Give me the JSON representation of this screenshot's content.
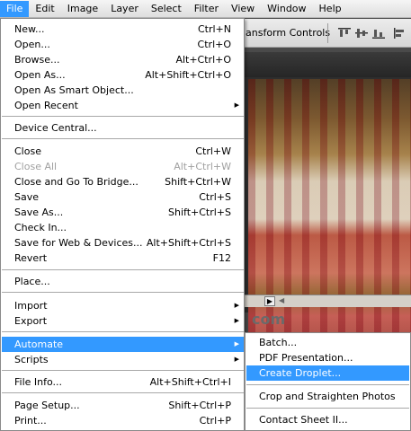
{
  "menubar": {
    "file": "File",
    "edit": "Edit",
    "image": "Image",
    "layer": "Layer",
    "select": "Select",
    "filter": "Filter",
    "view": "View",
    "window": "Window",
    "help": "Help"
  },
  "options": {
    "transform_controls": "ansform Controls"
  },
  "document": {
    "watermark": "com"
  },
  "file_menu": {
    "new": {
      "label": "New...",
      "shortcut": "Ctrl+N"
    },
    "open": {
      "label": "Open...",
      "shortcut": "Ctrl+O"
    },
    "browse": {
      "label": "Browse...",
      "shortcut": "Alt+Ctrl+O"
    },
    "open_as": {
      "label": "Open As...",
      "shortcut": "Alt+Shift+Ctrl+O"
    },
    "open_smart": {
      "label": "Open As Smart Object..."
    },
    "open_recent": {
      "label": "Open Recent"
    },
    "device_central": {
      "label": "Device Central..."
    },
    "close": {
      "label": "Close",
      "shortcut": "Ctrl+W"
    },
    "close_all": {
      "label": "Close All",
      "shortcut": "Alt+Ctrl+W"
    },
    "close_bridge": {
      "label": "Close and Go To Bridge...",
      "shortcut": "Shift+Ctrl+W"
    },
    "save": {
      "label": "Save",
      "shortcut": "Ctrl+S"
    },
    "save_as": {
      "label": "Save As...",
      "shortcut": "Shift+Ctrl+S"
    },
    "check_in": {
      "label": "Check In..."
    },
    "save_web": {
      "label": "Save for Web & Devices...",
      "shortcut": "Alt+Shift+Ctrl+S"
    },
    "revert": {
      "label": "Revert",
      "shortcut": "F12"
    },
    "place": {
      "label": "Place..."
    },
    "import": {
      "label": "Import"
    },
    "export": {
      "label": "Export"
    },
    "automate": {
      "label": "Automate"
    },
    "scripts": {
      "label": "Scripts"
    },
    "file_info": {
      "label": "File Info...",
      "shortcut": "Alt+Shift+Ctrl+I"
    },
    "page_setup": {
      "label": "Page Setup...",
      "shortcut": "Shift+Ctrl+P"
    },
    "print": {
      "label": "Print...",
      "shortcut": "Ctrl+P"
    }
  },
  "automate_menu": {
    "batch": "Batch...",
    "pdf": "PDF Presentation...",
    "droplet": "Create Droplet...",
    "crop": "Crop and Straighten Photos",
    "contact": "Contact Sheet II..."
  },
  "colors": {
    "highlight": "#3399ff",
    "disabled": "#a0a0a0"
  }
}
